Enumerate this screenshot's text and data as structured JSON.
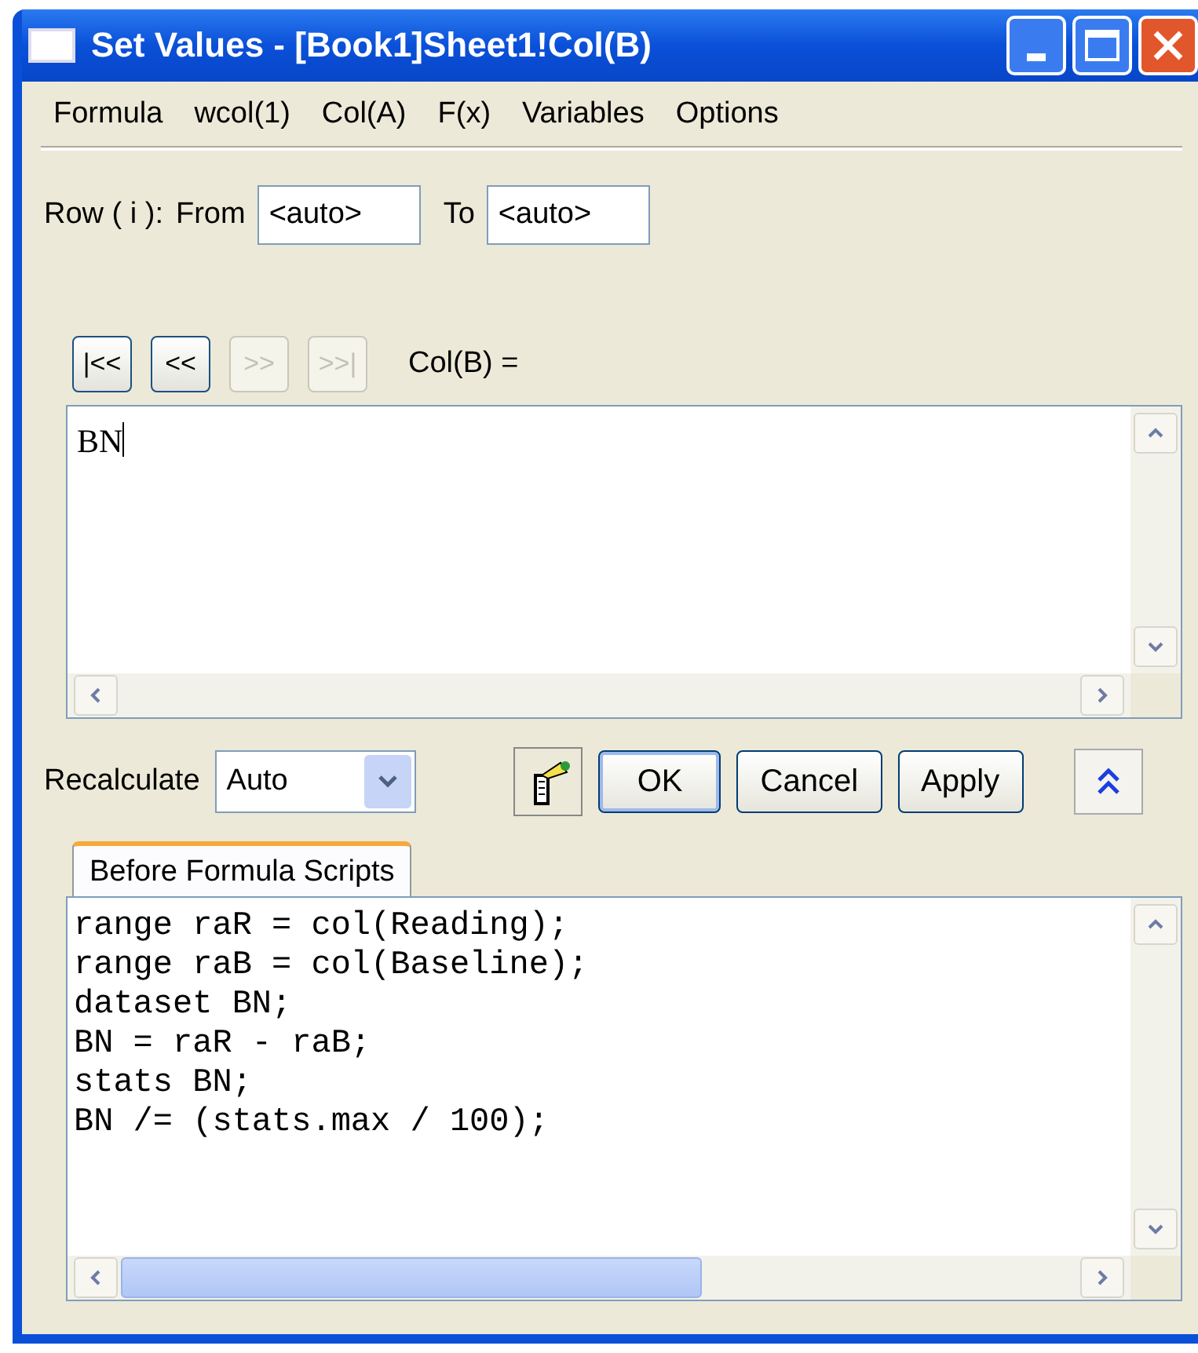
{
  "window": {
    "title": "Set Values - [Book1]Sheet1!Col(B)"
  },
  "menu": [
    "Formula",
    "wcol(1)",
    "Col(A)",
    "F(x)",
    "Variables",
    "Options"
  ],
  "row_range": {
    "label": "Row ( i ):",
    "from_label": "From",
    "from_value": "<auto>",
    "to_label": "To",
    "to_value": "<auto>"
  },
  "nav_buttons": [
    {
      "label": "|<<",
      "disabled": false
    },
    {
      "label": "<<",
      "disabled": false
    },
    {
      "label": ">>",
      "disabled": true
    },
    {
      "label": ">>|",
      "disabled": true
    }
  ],
  "formula": {
    "label": "Col(B) =",
    "value": "BN"
  },
  "recalculate": {
    "label": "Recalculate",
    "value": "Auto"
  },
  "buttons": [
    "OK",
    "Cancel",
    "Apply"
  ],
  "script_tab": {
    "label": "Before Formula Scripts",
    "selected": true
  },
  "script_lines": [
    "range raR = col(Reading);",
    "range raB = col(Baseline);",
    "dataset BN;",
    "BN = raR - raB;",
    "stats BN;",
    "BN /= (stats.max / 100);"
  ]
}
